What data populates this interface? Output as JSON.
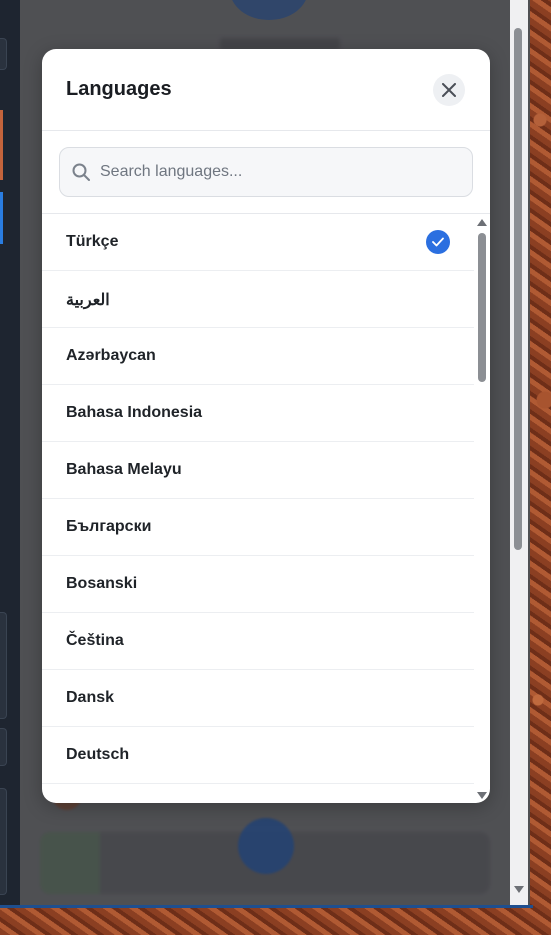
{
  "modal": {
    "title": "Languages",
    "close_icon": "close-icon",
    "search": {
      "placeholder": "Search languages...",
      "value": "",
      "icon": "search-icon"
    },
    "selected": "Türkçe",
    "accent": "#2b6fe0",
    "languages": [
      {
        "label": "Türkçe",
        "selected": true
      },
      {
        "label": "العربية",
        "selected": false
      },
      {
        "label": "Azərbaycan",
        "selected": false
      },
      {
        "label": "Bahasa Indonesia",
        "selected": false
      },
      {
        "label": "Bahasa Melayu",
        "selected": false
      },
      {
        "label": "Български",
        "selected": false
      },
      {
        "label": "Bosanski",
        "selected": false
      },
      {
        "label": "Čeština",
        "selected": false
      },
      {
        "label": "Dansk",
        "selected": false
      },
      {
        "label": "Deutsch",
        "selected": false
      }
    ]
  }
}
